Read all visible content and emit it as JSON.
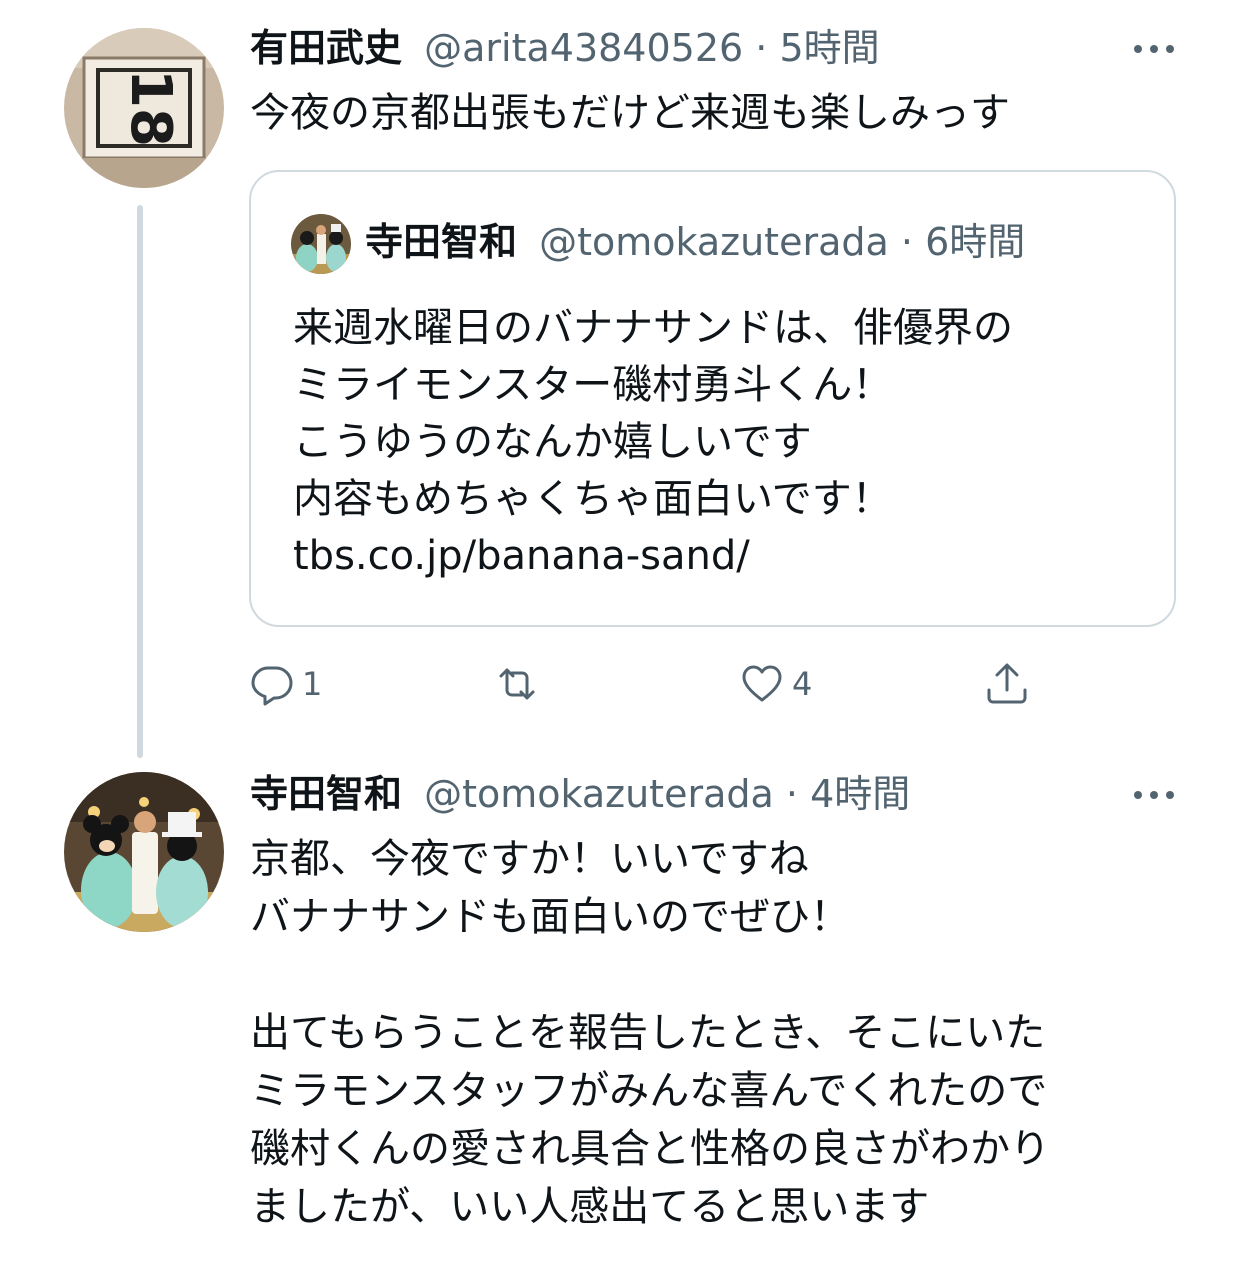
{
  "tweet1": {
    "name": "有田武史",
    "handle": "@arita43840526",
    "separator": "·",
    "time": "5時間",
    "text": "今夜の京都出張もだけど来週も楽しみっす",
    "avatar_icon": "jersey-number-avatar"
  },
  "quoted": {
    "name": "寺田智和",
    "handle": "@tomokazuterada",
    "separator": "·",
    "time": "6時間",
    "lines": [
      "来週水曜日のバナナサンドは、俳優界の",
      "ミライモンスター磯村勇斗くん！",
      "こうゆうのなんか嬉しいです",
      "内容もめちゃくちゃ面白いです！",
      "tbs.co.jp/banana-sand/"
    ]
  },
  "actions": {
    "reply_count": "1",
    "retweet_count": "",
    "like_count": "4"
  },
  "tweet2": {
    "name": "寺田智和",
    "handle": "@tomokazuterada",
    "separator": "·",
    "time": "4時間",
    "lines": [
      "京都、今夜ですか！いいですね",
      "バナナサンドも面白いのでぜひ！",
      "",
      "出てもらうことを報告したとき、そこにいた",
      "ミラモンスタッフがみんな喜んでくれたので",
      "磯村くんの愛され具合と性格の良さがわかり",
      "ましたが、いい人感出てると思います"
    ]
  },
  "colors": {
    "text_primary": "#0f1419",
    "text_secondary": "#536471",
    "border": "#cfd9de"
  }
}
